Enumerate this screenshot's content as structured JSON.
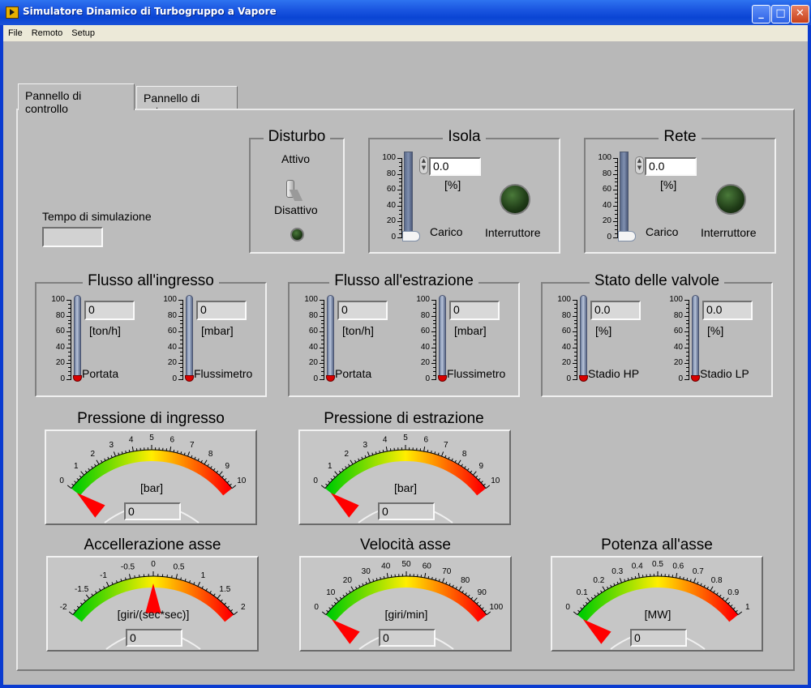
{
  "window": {
    "title": "Simulatore Dinamico di Turbogruppo a Vapore",
    "buttons": {
      "minimize": "_",
      "maximize": "□",
      "close": "✕"
    }
  },
  "menu": [
    "File",
    "Remoto",
    "Setup"
  ],
  "tabs": [
    {
      "label": "Pannello di controllo",
      "active": true
    },
    {
      "label": "Pannello di setup",
      "active": false
    }
  ],
  "sim": {
    "label": "Tempo di simulazione",
    "value": ""
  },
  "disturbo": {
    "title": "Disturbo",
    "on_label": "Attivo",
    "off_label": "Disattivo",
    "state": "Disattivo"
  },
  "isola": {
    "title": "Isola",
    "value": "0.0",
    "unit": "[%]",
    "slider_label": "Carico",
    "led_label": "Interruttore",
    "slider_value": 0
  },
  "rete": {
    "title": "Rete",
    "value": "0.0",
    "unit": "[%]",
    "slider_label": "Carico",
    "led_label": "Interruttore",
    "slider_value": 0
  },
  "scale": [
    "100",
    "80",
    "60",
    "40",
    "20",
    "0"
  ],
  "flusso_ingresso": {
    "title": "Flusso all'ingresso",
    "left": {
      "value": "0",
      "unit": "[ton/h]",
      "label": "Portata",
      "level": 0
    },
    "right": {
      "value": "0",
      "unit": "[mbar]",
      "label": "Flussimetro",
      "level": 0
    }
  },
  "flusso_estrazione": {
    "title": "Flusso all'estrazione",
    "left": {
      "value": "0",
      "unit": "[ton/h]",
      "label": "Portata",
      "level": 0
    },
    "right": {
      "value": "0",
      "unit": "[mbar]",
      "label": "Flussimetro",
      "level": 0
    }
  },
  "valvole": {
    "title": "Stato delle valvole",
    "left": {
      "value": "0.0",
      "unit": "[%]",
      "label": "Stadio HP",
      "level": 0
    },
    "right": {
      "value": "0.0",
      "unit": "[%]",
      "label": "Stadio LP",
      "level": 0
    }
  },
  "gauges": [
    {
      "key": "g1",
      "title": "Pressione di ingresso",
      "unit": "[bar]",
      "value": "0",
      "ticks": [
        "0",
        "1",
        "2",
        "3",
        "4",
        "5",
        "6",
        "7",
        "8",
        "9",
        "10"
      ],
      "min": 0,
      "max": 10,
      "reading": 0
    },
    {
      "key": "g2",
      "title": "Pressione di estrazione",
      "unit": "[bar]",
      "value": "0",
      "ticks": [
        "0",
        "1",
        "2",
        "3",
        "4",
        "5",
        "6",
        "7",
        "8",
        "9",
        "10"
      ],
      "min": 0,
      "max": 10,
      "reading": 0
    },
    {
      "key": "g3",
      "title": "Accellerazione asse",
      "unit": "[giri/(sec*sec)]",
      "value": "0",
      "ticks": [
        "-2",
        "-1.5",
        "-1",
        "-0.5",
        "0",
        "0.5",
        "1",
        "1.5",
        "2"
      ],
      "min": -2,
      "max": 2,
      "reading": 0
    },
    {
      "key": "g4",
      "title": "Velocità asse",
      "unit": "[giri/min]",
      "value": "0",
      "ticks": [
        "0",
        "10",
        "20",
        "30",
        "40",
        "50",
        "60",
        "70",
        "80",
        "90",
        "100"
      ],
      "min": 0,
      "max": 100,
      "reading": 0
    },
    {
      "key": "g5",
      "title": "Potenza all'asse",
      "unit": "[MW]",
      "value": "0",
      "ticks": [
        "0",
        "0.1",
        "0.2",
        "0.3",
        "0.4",
        "0.5",
        "0.6",
        "0.7",
        "0.8",
        "0.9",
        "1"
      ],
      "min": 0,
      "max": 1,
      "reading": 0
    }
  ],
  "colors": {
    "needle": "#ff0000",
    "arc_low": "#00cc00",
    "arc_mid": "#ffee00",
    "arc_high": "#ff0000",
    "led_off": "#2a4a1e"
  }
}
